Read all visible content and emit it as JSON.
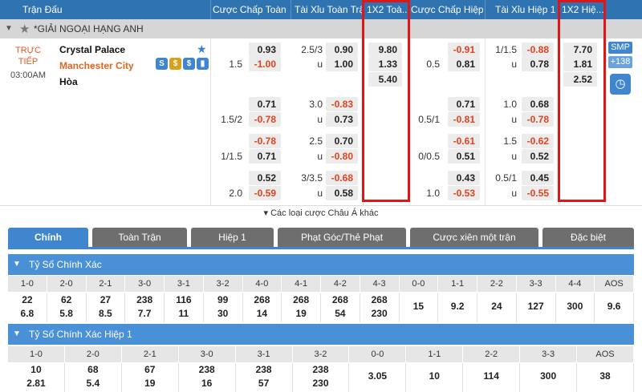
{
  "header": {
    "col_match": "Trận Đấu",
    "col_ah_ft": "Cược Chấp Toàn ...",
    "col_ou_ft": "Tài Xỉu Toàn Trận",
    "col_1x2_ft": "1X2 Toà...",
    "col_ah_h1": "Cược Chấp Hiệp 1",
    "col_ou_h1": "Tài Xỉu Hiệp 1",
    "col_1x2_h1": "1X2 Hiệ..."
  },
  "league": {
    "name": "*GIẢI NGOẠI HẠNG ANH"
  },
  "match": {
    "status_line1": "TRỰC",
    "status_line2": "TIẾP",
    "time": "03:00AM",
    "home": "Crystal Palace",
    "away": "Manchester City",
    "draw": "Hòa",
    "icons": [
      "S",
      "$",
      "$",
      "chart"
    ]
  },
  "odds_rows": [
    {
      "ah_ft_line_top": "",
      "ah_ft_top": "0.93",
      "ah_ft_line_bot": "1.5",
      "ah_ft_bot": "-1.00",
      "ou_ft_line": "2.5/3",
      "ou_ft_top": "0.90",
      "ou_ft_u": "u",
      "ou_ft_bot": "1.00",
      "x12_ft": [
        "9.80",
        "1.33",
        "5.40"
      ],
      "ah_h1_line_bot": "0.5",
      "ah_h1_top": "-0.91",
      "ah_h1_bot": "0.81",
      "ou_h1_line": "1/1.5",
      "ou_h1_top": "-0.88",
      "ou_h1_u": "u",
      "ou_h1_bot": "0.78",
      "x12_h1": [
        "7.70",
        "1.81",
        "2.52"
      ]
    },
    {
      "ah_ft_line_bot": "1.5/2",
      "ah_ft_top": "0.71",
      "ah_ft_bot": "-0.78",
      "ou_ft_line": "3.0",
      "ou_ft_top": "-0.83",
      "ou_ft_u": "u",
      "ou_ft_bot": "0.73",
      "ah_h1_line_bot": "0.5/1",
      "ah_h1_top": "0.71",
      "ah_h1_bot": "-0.81",
      "ou_h1_line": "1.0",
      "ou_h1_top": "0.68",
      "ou_h1_u": "u",
      "ou_h1_bot": "-0.78"
    },
    {
      "ah_ft_line_bot": "1/1.5",
      "ah_ft_top": "-0.78",
      "ah_ft_bot": "0.71",
      "ou_ft_line": "2.5",
      "ou_ft_top": "0.70",
      "ou_ft_u": "u",
      "ou_ft_bot": "-0.80",
      "ah_h1_line_bot": "0/0.5",
      "ah_h1_top": "-0.61",
      "ah_h1_bot": "0.51",
      "ou_h1_line": "1.5",
      "ou_h1_top": "-0.62",
      "ou_h1_u": "u",
      "ou_h1_bot": "0.52"
    },
    {
      "ah_ft_line_bot": "2.0",
      "ah_ft_top": "0.52",
      "ah_ft_bot": "-0.59",
      "ou_ft_line": "3/3.5",
      "ou_ft_top": "-0.68",
      "ou_ft_u": "u",
      "ou_ft_bot": "0.58",
      "ah_h1_line_bot": "1.0",
      "ah_h1_top": "0.43",
      "ah_h1_bot": "-0.53",
      "ou_h1_line": "0.5/1",
      "ou_h1_top": "0.45",
      "ou_h1_u": "u",
      "ou_h1_bot": "-0.55"
    }
  ],
  "side": {
    "smp": "SMP",
    "count": "138"
  },
  "more_link": "▾ Các loại cược Châu Á khác",
  "tabs": [
    "Chính",
    "Toàn Trận",
    "Hiệp 1",
    "Phạt Góc/Thẻ Phạt",
    "Cược xiên một trận",
    "Đặc biệt"
  ],
  "correct_score": {
    "title": "Tỷ Số Chính Xác",
    "headers": [
      "1-0",
      "2-0",
      "2-1",
      "3-0",
      "3-1",
      "3-2",
      "4-0",
      "4-1",
      "4-2",
      "4-3",
      "0-0",
      "1-1",
      "2-2",
      "3-3",
      "4-4",
      "AOS"
    ],
    "top": [
      "22",
      "62",
      "27",
      "238",
      "116",
      "99",
      "268",
      "268",
      "268",
      "268",
      "15",
      "9.2",
      "24",
      "127",
      "300",
      "9.6"
    ],
    "bot": [
      "6.8",
      "5.8",
      "8.5",
      "7.7",
      "11",
      "30",
      "14",
      "19",
      "54",
      "230",
      "",
      "",
      "",
      "",
      "",
      ""
    ]
  },
  "correct_score_h1": {
    "title": "Tỷ Số Chính Xác Hiệp 1",
    "headers": [
      "1-0",
      "2-0",
      "2-1",
      "3-0",
      "3-1",
      "3-2",
      "0-0",
      "1-1",
      "2-2",
      "3-3",
      "AOS"
    ],
    "top": [
      "10",
      "68",
      "67",
      "238",
      "238",
      "238",
      "3.05",
      "10",
      "114",
      "300",
      "38"
    ],
    "bot": [
      "2.81",
      "5.4",
      "19",
      "16",
      "57",
      "230",
      "",
      "",
      "",
      "",
      ""
    ]
  },
  "colors": {
    "header_bg": "#2f73b0",
    "accent": "#3f86cf",
    "negative": "#e3421e",
    "highlight_box": "#e01616"
  }
}
